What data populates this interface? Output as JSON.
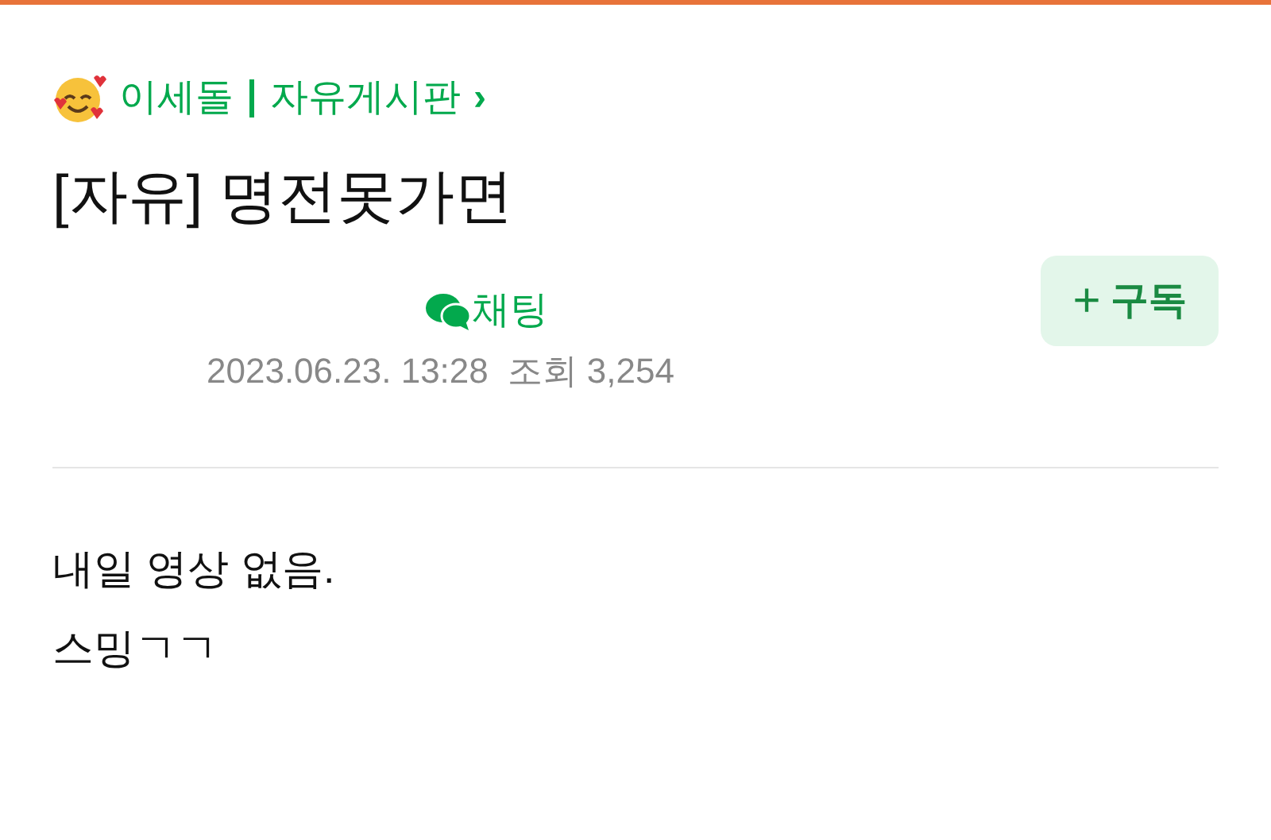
{
  "cafe": {
    "name": "이세돌",
    "board": "자유게시판",
    "chevron": "›"
  },
  "title": "[자유] 명전못가면",
  "meta": {
    "chat": "채팅",
    "date": "2023.06.23. 13:28",
    "views_label": "조회",
    "views": "3,254"
  },
  "subscribe": {
    "icon": "+",
    "label": "구독"
  },
  "body": [
    "내일 영상 없음.",
    "스밍ㄱㄱ"
  ]
}
